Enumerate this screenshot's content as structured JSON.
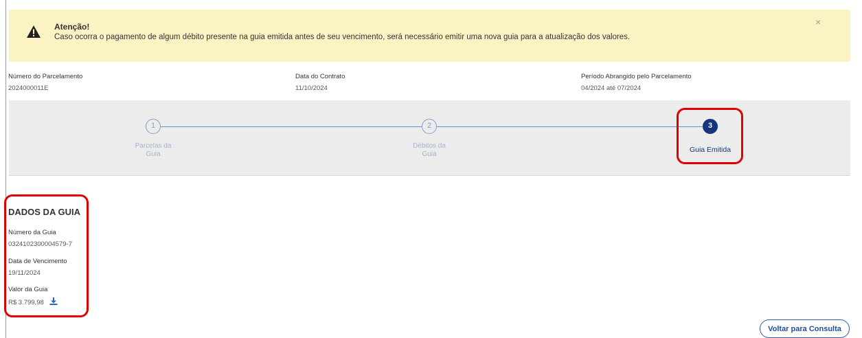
{
  "alert": {
    "title": "Atenção!",
    "message": "Caso ocorra o pagamento de algum débito presente na guia emitida antes de seu vencimento, será necessário emitir uma nova guia para a atualização dos valores.",
    "close_label": "×",
    "icon": "warning-icon"
  },
  "contract": {
    "numero_label": "Número do Parcelamento",
    "numero_value": "2024000011E",
    "data_label": "Data do Contrato",
    "data_value": "11/10/2024",
    "periodo_label": "Período Abrangido pelo Parcelamento",
    "periodo_value": "04/2024 até 07/2024"
  },
  "stepper": {
    "steps": [
      {
        "number": "1",
        "label_line1": "Parcelas da",
        "label_line2": "Guia",
        "state": "done"
      },
      {
        "number": "2",
        "label_line1": "Débitos da",
        "label_line2": "Guia",
        "state": "done"
      },
      {
        "number": "3",
        "label_line1": "Guia Emitida",
        "label_line2": "",
        "state": "active"
      }
    ]
  },
  "guia": {
    "section_title": "DADOS DA GUIA",
    "numero_label": "Número da Guia",
    "numero_value": "03241023000045797",
    "numero_display": "0324102300004579-7",
    "vencimento_label": "Data de Vencimento",
    "vencimento_value": "19/11/2024",
    "valor_label": "Valor da Guia",
    "valor_value": "R$ 3.799,98",
    "download_icon": "download-icon"
  },
  "actions": {
    "back_label": "Voltar para Consulta"
  },
  "colors": {
    "alert_bg": "#fcf3c4",
    "stepper_bg": "#ececec",
    "active_step": "#14367d",
    "step_line": "#5f93d4",
    "highlight": "#e00000"
  }
}
